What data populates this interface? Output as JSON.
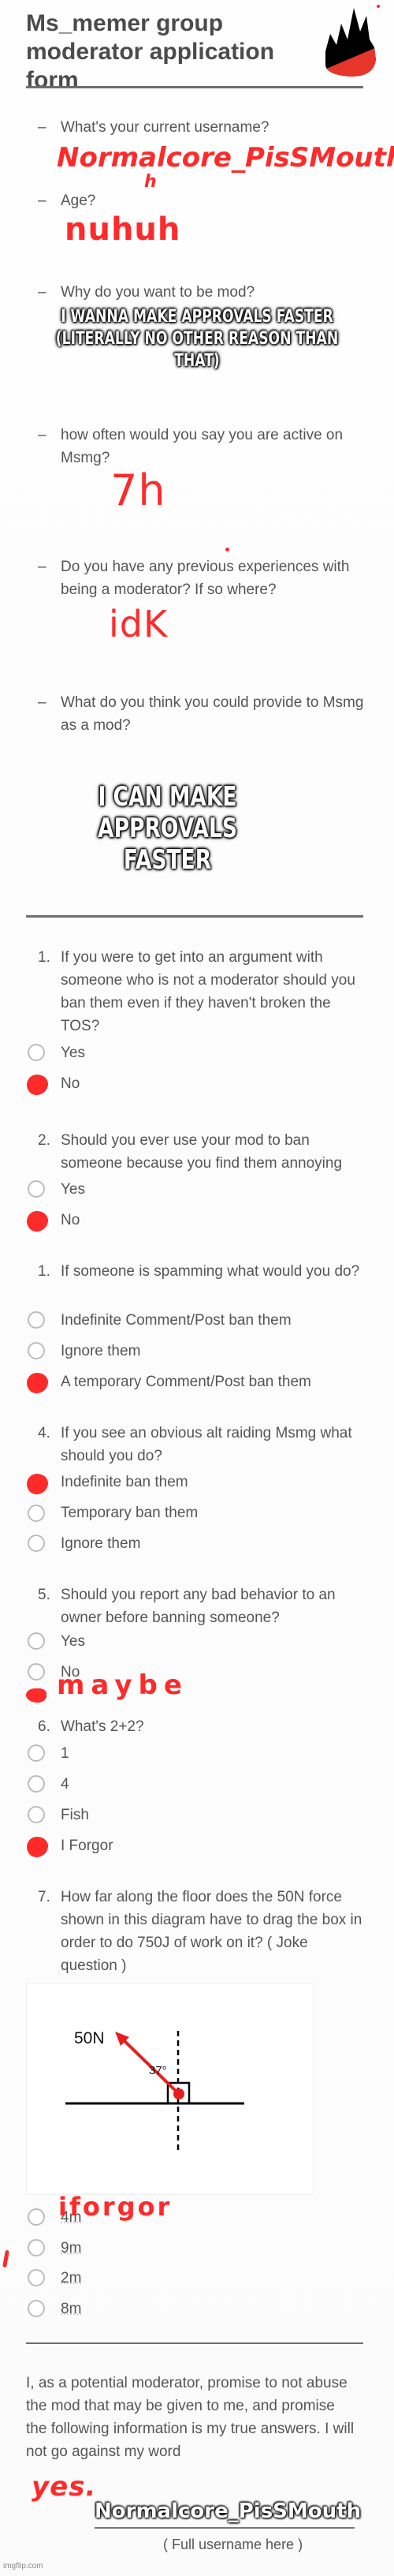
{
  "form": {
    "title": "Ms_memer group moderator application form",
    "logo_icon": "flame-logo-icon",
    "colors": {
      "accent_red": "#ff2a2a",
      "logo_black": "#000000",
      "logo_red": "#e8352b",
      "text": "#555555"
    }
  },
  "short_questions": [
    {
      "bullet": "–",
      "question": "What's your current username?",
      "answer": "Normalcore_PisSMouth",
      "answer_note": "h"
    },
    {
      "bullet": "–",
      "question": "Age?",
      "answer": "nuhuh"
    },
    {
      "bullet": "–",
      "question": "Why do you want to be mod?",
      "answer": "I WANNA MAKE APPROVALS FASTER (LITERALLY NO OTHER REASON THAN THAT)"
    },
    {
      "bullet": "–",
      "question": "how often would you say you are active on Msmg?",
      "answer": "7h"
    },
    {
      "bullet": "–",
      "question": "Do you have any previous experiences with being a moderator? If so where?",
      "answer": "idK"
    },
    {
      "bullet": "–",
      "question": "What do you think you could provide to Msmg as a mod?",
      "answer": "I CAN MAKE APPROVALS FASTER"
    }
  ],
  "mc_questions": [
    {
      "number": "1.",
      "question": "If you were to get into an argument with someone who is not a moderator should you ban them even if they haven't broken the TOS?",
      "options": [
        "Yes",
        "No"
      ],
      "selected": "No"
    },
    {
      "number": "2.",
      "question": "Should you ever use your mod to ban someone because you find them annoying",
      "options": [
        "Yes",
        "No"
      ],
      "selected": "No"
    },
    {
      "number": "1.",
      "question": "If someone is spamming what would you do?",
      "options": [
        "Indefinite Comment/Post ban them",
        "Ignore them",
        "A temporary Comment/Post ban them"
      ],
      "selected": "A temporary Comment/Post ban them"
    },
    {
      "number": "4.",
      "question": "If you see an obvious alt raiding Msmg what should you do?",
      "options": [
        "Indefinite ban them",
        "Temporary ban them",
        "Ignore them"
      ],
      "selected": "Indefinite ban them"
    },
    {
      "number": "5.",
      "question": "Should you report any bad behavior to an owner before banning someone?",
      "options": [
        "Yes",
        "No"
      ],
      "selected": "maybe",
      "handwritten_answer": "maybe"
    },
    {
      "number": "6.",
      "question": "What's 2+2?",
      "options": [
        "1",
        "4",
        "Fish",
        "I Forgor"
      ],
      "selected": "I Forgor"
    },
    {
      "number": "7.",
      "question": "How far along the floor does the 50N force shown in this diagram have to drag the box in order to do 750J of work on it? ( Joke question )",
      "options": [
        "4m",
        "9m",
        "2m",
        "8m"
      ],
      "selected": "",
      "handwritten_answer": "iforgor"
    }
  ],
  "diagram": {
    "force_label": "50N",
    "angle_label": "37°"
  },
  "pledge": {
    "text": "I, as a potential moderator, promise to not abuse the mod that may be given to me, and promise the following information is my true answers. I will not go against my word",
    "handwritten_answer": "yes.",
    "signature": "Normalcore_PisSMouth",
    "signature_caption": "( Full username here )"
  },
  "watermark": "imgflip.com"
}
